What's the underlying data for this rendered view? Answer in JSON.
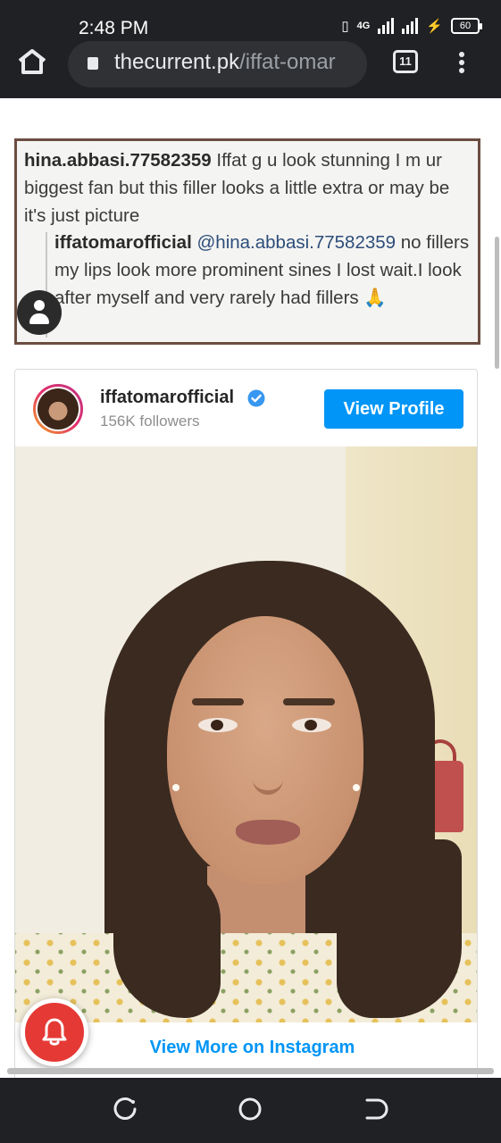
{
  "status_bar": {
    "time": "2:48 PM",
    "network": "4G",
    "battery": "60"
  },
  "browser": {
    "url_host": "thecurrent.pk",
    "url_path": "/iffat-omar",
    "tab_count": "11"
  },
  "comment_screenshot": {
    "comment_user": "hina.abbasi.77582359",
    "comment_text": " Iffat g u look stunning I m ur biggest fan but this  filler looks a little extra or may be it's just picture",
    "reply_user": "iffatomarofficial",
    "reply_mention": " @hina.abbasi.77582359",
    "reply_text": " no fillers my lips look more prominent sines I lost wait.I look after myself and very rarely had fillers 🙏"
  },
  "instagram_embed": {
    "username": "iffatomarofficial",
    "followers": "156K followers",
    "view_profile_label": "View Profile",
    "view_more_label": "View More on Instagram"
  },
  "colors": {
    "instagram_blue": "#0095f6",
    "bell_red": "#e53935",
    "chrome_dark": "#202124"
  },
  "icons": [
    "home-icon",
    "lock-icon",
    "tabs-icon",
    "menu-icon",
    "verified-icon",
    "bell-icon",
    "recent-apps-icon",
    "home-circle-icon",
    "back-icon"
  ]
}
